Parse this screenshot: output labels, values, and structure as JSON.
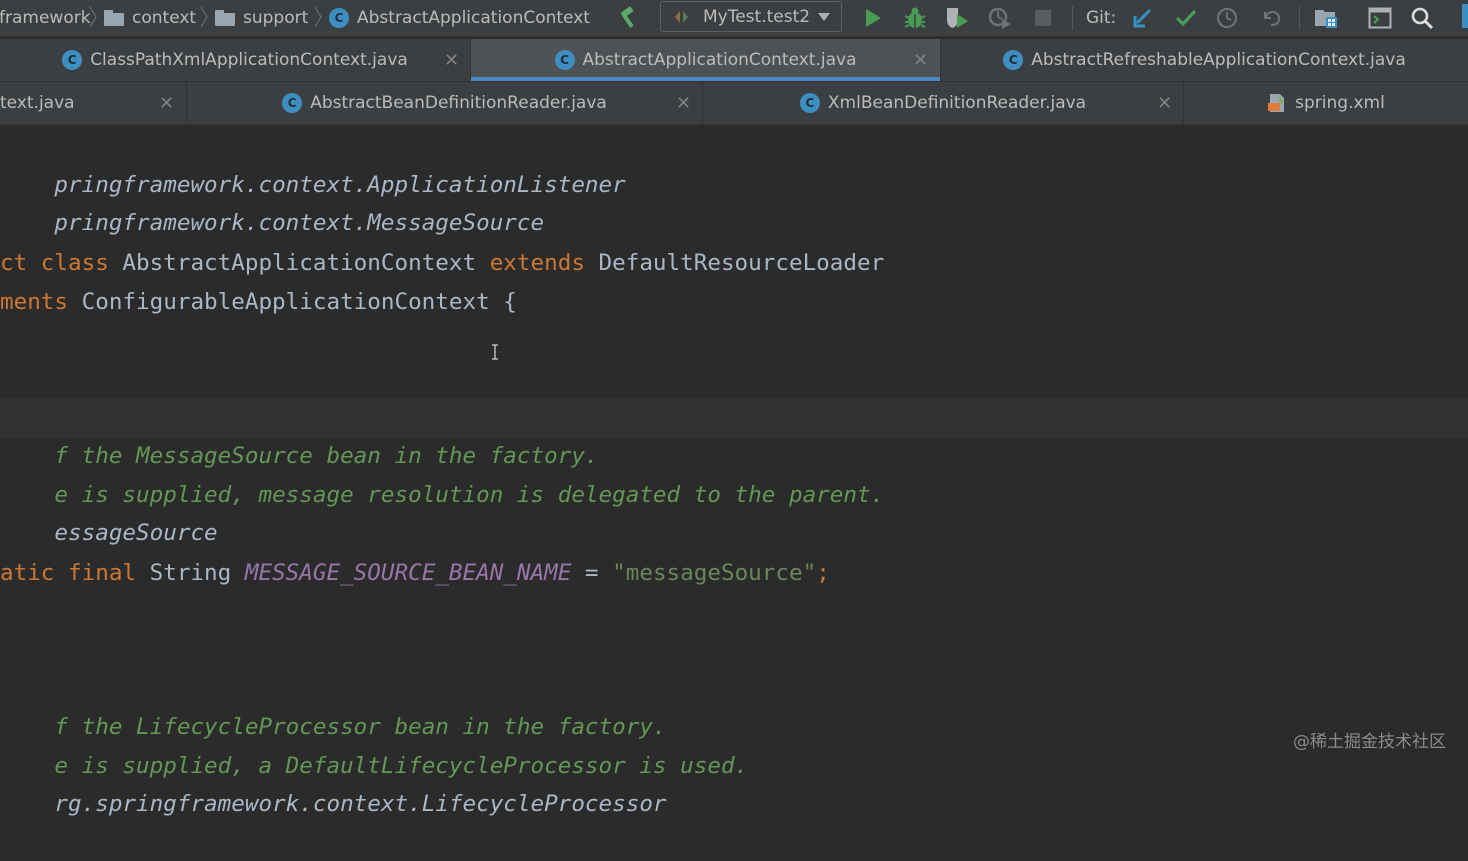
{
  "breadcrumbs": [
    {
      "label": "framework",
      "icon": "folder-icon"
    },
    {
      "label": "context",
      "icon": "folder-icon"
    },
    {
      "label": "support",
      "icon": "folder-icon"
    },
    {
      "label": "AbstractApplicationContext",
      "icon": "class-icon"
    }
  ],
  "toolbar": {
    "run_config": "MyTest.test2",
    "git_label": "Git:",
    "class_badge": "C"
  },
  "tabs_row1": [
    {
      "label": "ClassPathXmlApplicationContext.java",
      "active": false
    },
    {
      "label": "AbstractApplicationContext.java",
      "active": true
    },
    {
      "label": "AbstractRefreshableApplicationContext.java",
      "active": false
    }
  ],
  "tabs_row2": [
    {
      "label": "text.java"
    },
    {
      "label": "AbstractBeanDefinitionReader.java"
    },
    {
      "label": "XmlBeanDefinitionReader.java"
    },
    {
      "label": "spring.xml"
    }
  ],
  "code": {
    "l1": "pringframework.context.ApplicationListener",
    "l2": "pringframework.context.MessageSource",
    "l3_kw1": "ct class",
    "l3_name": " AbstractApplicationContext ",
    "l3_kw2": "extends",
    "l3_base": " DefaultResourceLoader",
    "l4_kw": "ments",
    "l4_rest": " ConfigurableApplicationContext {",
    "l5": "f the MessageSource bean in the factory.",
    "l6": "e is supplied, message resolution is delegated to the parent.",
    "l7": "essageSource",
    "l8_kw": "atic final",
    "l8_type": " String ",
    "l8_const": "MESSAGE_SOURCE_BEAN_NAME",
    "l8_eq": " = ",
    "l8_str": "\"messageSource\"",
    "l8_semi": ";",
    "l9": "f the LifecycleProcessor bean in the factory.",
    "l10": "e is supplied, a DefaultLifecycleProcessor is used.",
    "l11": "rg.springframework.context.LifecycleProcessor"
  },
  "watermark": "@稀土掘金技术社区",
  "colors": {
    "accent": "#4a88c7",
    "keyword": "#cc7832",
    "comment": "#629755",
    "constant": "#9876aa",
    "string": "#6a8759",
    "plain": "#a9b7c6"
  }
}
